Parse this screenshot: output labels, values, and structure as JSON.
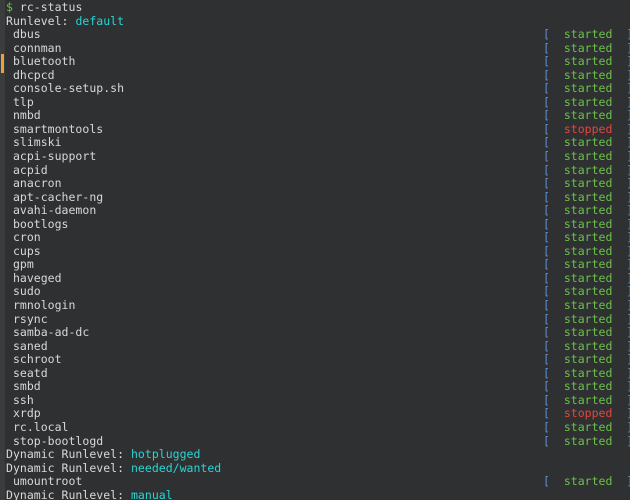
{
  "terminal": {
    "background_color": "#2e3032",
    "prompt": {
      "symbol": "$",
      "symbol_color": "#6cc24a",
      "command": "rc-status"
    },
    "runlevel_header": {
      "label": "Runlevel:",
      "value": "default",
      "value_color": "#27d6d6"
    },
    "status_labels": {
      "open_bracket": "[",
      "close_bracket": "]",
      "started": "started",
      "stopped": "stopped",
      "started_color": "#6cc24a",
      "stopped_color": "#e8453c",
      "bracket_color": "#5c8fd6"
    },
    "dynamic_runlevel_label": "Dynamic Runlevel:",
    "services": [
      {
        "name": "dbus",
        "status": "started"
      },
      {
        "name": "connman",
        "status": "started"
      },
      {
        "name": "bluetooth",
        "status": "started"
      },
      {
        "name": "dhcpcd",
        "status": "started"
      },
      {
        "name": "console-setup.sh",
        "status": "started"
      },
      {
        "name": "tlp",
        "status": "started"
      },
      {
        "name": "nmbd",
        "status": "started"
      },
      {
        "name": "smartmontools",
        "status": "stopped"
      },
      {
        "name": "slimski",
        "status": "started"
      },
      {
        "name": "acpi-support",
        "status": "started"
      },
      {
        "name": "acpid",
        "status": "started"
      },
      {
        "name": "anacron",
        "status": "started"
      },
      {
        "name": "apt-cacher-ng",
        "status": "started"
      },
      {
        "name": "avahi-daemon",
        "status": "started"
      },
      {
        "name": "bootlogs",
        "status": "started"
      },
      {
        "name": "cron",
        "status": "started"
      },
      {
        "name": "cups",
        "status": "started"
      },
      {
        "name": "gpm",
        "status": "started"
      },
      {
        "name": "haveged",
        "status": "started"
      },
      {
        "name": "sudo",
        "status": "started"
      },
      {
        "name": "rmnologin",
        "status": "started"
      },
      {
        "name": "rsync",
        "status": "started"
      },
      {
        "name": "samba-ad-dc",
        "status": "started"
      },
      {
        "name": "saned",
        "status": "started"
      },
      {
        "name": "schroot",
        "status": "started"
      },
      {
        "name": "seatd",
        "status": "started"
      },
      {
        "name": "smbd",
        "status": "started"
      },
      {
        "name": "ssh",
        "status": "started"
      },
      {
        "name": "xrdp",
        "status": "stopped"
      },
      {
        "name": "rc.local",
        "status": "started"
      },
      {
        "name": "stop-bootlogd",
        "status": "started"
      }
    ],
    "dynamic_runlevels": [
      {
        "value": "hotplugged",
        "services": []
      },
      {
        "value": "needed/wanted",
        "services": [
          {
            "name": "umountroot",
            "status": "started"
          }
        ]
      },
      {
        "value": "manual",
        "services": []
      }
    ],
    "scrollbar": {
      "thumb_color": "#e8a33d",
      "track_color": "#3a3c3e"
    }
  }
}
